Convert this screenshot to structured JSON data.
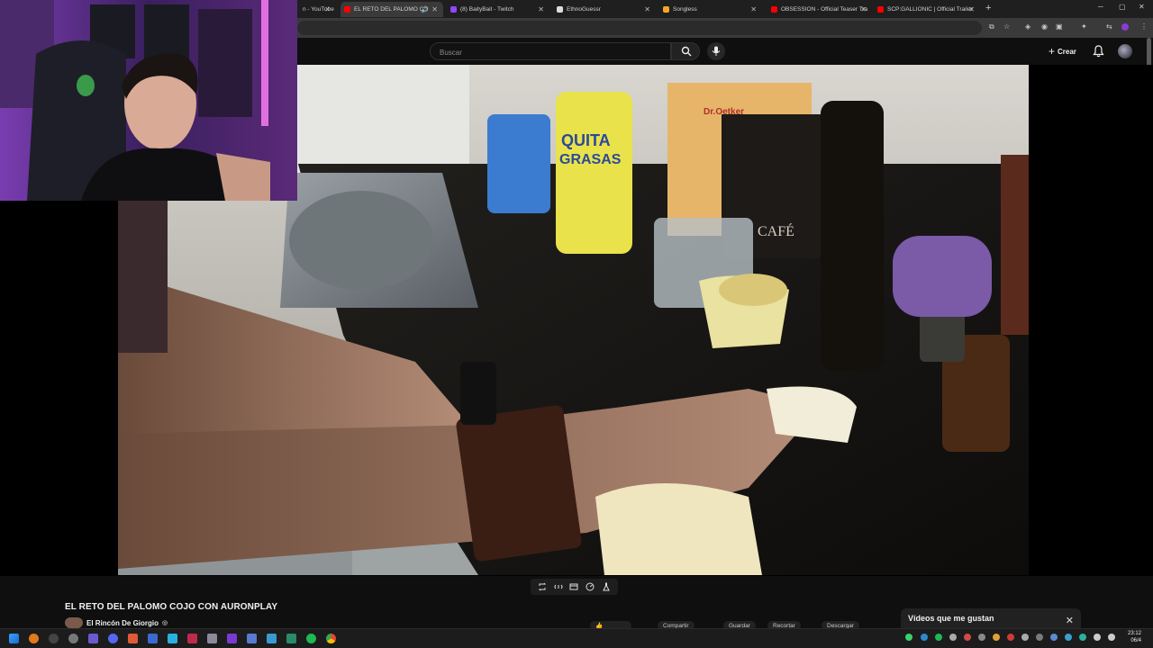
{
  "browser": {
    "tabs": [
      {
        "label": "n - YouTube",
        "favicon_color": "#ff0000",
        "active": false
      },
      {
        "label": "EL RETO DEL PALOMO CO",
        "favicon_color": "#ff0000",
        "active": true
      },
      {
        "label": "(8) BaityBait - Twitch",
        "favicon_color": "#9146ff",
        "active": false
      },
      {
        "label": "EthnoGuessr",
        "favicon_color": "#e0e0e0",
        "active": false
      },
      {
        "label": "Songless",
        "favicon_color": "#f5a623",
        "active": false
      },
      {
        "label": "OBSESSION - Official Teaser Tra",
        "favicon_color": "#ff0000",
        "active": false
      },
      {
        "label": "SCP:GALLIONIC | Official Trailer",
        "favicon_color": "#ff0000",
        "active": false
      }
    ],
    "new_tab_icon": "plus-icon",
    "window_controls": [
      "minimize-icon",
      "restore-icon",
      "close-icon"
    ]
  },
  "youtube": {
    "search_placeholder": "Buscar",
    "create_label": "Crear",
    "video_title": "EL RETO DEL PALOMO COJO CON AURONPLAY",
    "channel_name": "El Rincón De Giorgio",
    "actions": [
      "Compartir",
      "Guardar",
      "Recortar",
      "Descargar"
    ],
    "liked_panel_title": "Vídeos que me gustan",
    "brand_color": "#ff0000"
  },
  "taskbar": {
    "time": "23:12",
    "date": "06/4"
  }
}
